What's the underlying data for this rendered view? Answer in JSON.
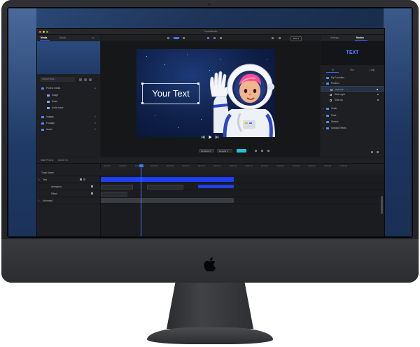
{
  "app": {
    "title": "ComicStudio"
  },
  "left_panel": {
    "tabs": [
      "Media",
      "Studio"
    ],
    "search_placeholder": "Search files...",
    "tree": [
      {
        "label": "Project media",
        "count": "●",
        "indent": 0
      },
      {
        "label": "Image",
        "count": "",
        "indent": 1
      },
      {
        "label": "Video",
        "count": "",
        "indent": 1
      },
      {
        "label": "Audio track",
        "count": "",
        "indent": 1
      },
      {
        "label": "Images",
        "count": "5",
        "indent": 0
      },
      {
        "label": "Footage",
        "count": "5",
        "indent": 0
      },
      {
        "label": "Audio",
        "count": "5",
        "indent": 0
      }
    ]
  },
  "viewer": {
    "zoom": "50% ▾",
    "canvas_text": "Your Text",
    "tool_selects": [
      "Helvetica ▾",
      "Regular ▾"
    ]
  },
  "right_panel": {
    "tabs": [
      "Settings",
      "Motion"
    ],
    "preview_label": "TEXT",
    "subtabs": [
      "In",
      "Out",
      "Loop"
    ],
    "rows": [
      {
        "label": "My Favorites",
        "kind": "folder"
      },
      {
        "label": "Position",
        "kind": "folder"
      },
      {
        "label": "Slide left",
        "kind": "item",
        "selected": true
      },
      {
        "label": "Slide right",
        "kind": "item"
      },
      {
        "label": "Slide up",
        "kind": "item"
      },
      {
        "label": "Scale",
        "kind": "folder"
      },
      {
        "label": "Fade",
        "kind": "folder"
      },
      {
        "label": "Stretch",
        "kind": "folder"
      },
      {
        "label": "Special Effects",
        "kind": "folder"
      }
    ]
  },
  "timeline": {
    "header_tabs": [
      "Main Project",
      "Scene 01"
    ],
    "ruler_ticks": [
      "00:00:00",
      "00:00:02",
      "00:00:04",
      "00:00:06",
      "00:00:08",
      "00:00:10",
      "00:00:12",
      "00:00:14",
      "00:00:16",
      "00:00:18",
      "00:00:20",
      "00:00:22",
      "00:00:24",
      "00:00:26",
      "00:00:28",
      "00:00:30"
    ],
    "tracks": [
      {
        "label": "Track Name"
      },
      {
        "label": "Text"
      },
      {
        "label": "Animation"
      },
      {
        "label": "Effect"
      },
      {
        "label": "Astronaut"
      }
    ]
  },
  "colors": {
    "accent": "#2d6bff",
    "clip_blue": "#1f3ff0",
    "swatch": "#25c3d6"
  }
}
